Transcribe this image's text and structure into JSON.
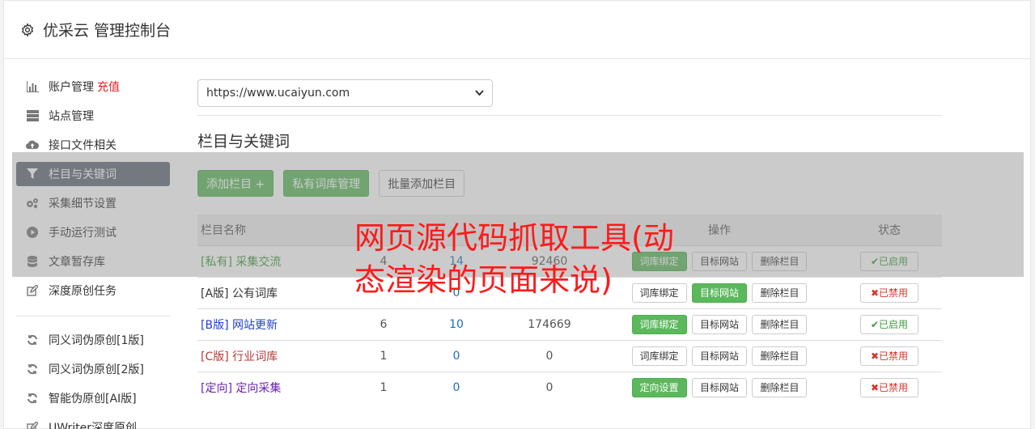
{
  "header": {
    "title": "优采云 管理控制台"
  },
  "sidebar": {
    "items": [
      {
        "label": "账户管理",
        "extra": "充值",
        "icon": "bar-chart-icon"
      },
      {
        "label": "站点管理",
        "icon": "server-icon"
      },
      {
        "label": "接口文件相关",
        "icon": "cloud-upload-icon"
      },
      {
        "label": "栏目与关键词",
        "icon": "filter-icon"
      },
      {
        "label": "采集细节设置",
        "icon": "cogs-icon"
      },
      {
        "label": "手动运行测试",
        "icon": "play-icon"
      },
      {
        "label": "文章暂存库",
        "icon": "database-icon"
      },
      {
        "label": "深度原创任务",
        "icon": "edit-icon"
      }
    ],
    "items2": [
      {
        "label": "同义词伪原创[1版]",
        "icon": "refresh-icon"
      },
      {
        "label": "同义词伪原创[2版]",
        "icon": "refresh-icon"
      },
      {
        "label": "智能伪原创[AI版]",
        "icon": "refresh-icon"
      },
      {
        "label": "UWriter深度原创",
        "icon": "edit-icon"
      }
    ]
  },
  "main": {
    "site_select": "https://www.ucaiyun.com",
    "section_title": "栏目与关键词",
    "buttons": {
      "add_column": "添加栏目 +",
      "private_lib": "私有词库管理",
      "batch_add": "批量添加栏目"
    },
    "table": {
      "headers": [
        "栏目名称",
        "",
        "",
        "",
        "操作",
        "状态"
      ],
      "rows": [
        {
          "name": "[私有] 采集交流",
          "a": "4",
          "b": "14",
          "c": "92460",
          "op1": "词库绑定",
          "op2": "目标网站",
          "op3": "删除栏目",
          "status": "✔已启用"
        },
        {
          "name": "[A版] 公有词库",
          "a": "",
          "b": "0",
          "c": "",
          "op1": "词库绑定",
          "op2": "目标网站",
          "op3": "删除栏目",
          "status": "✖已禁用"
        },
        {
          "name": "[B版] 网站更新",
          "a": "6",
          "b": "10",
          "c": "174669",
          "op1": "词库绑定",
          "op2": "目标网站",
          "op3": "删除栏目",
          "status": "✔已启用"
        },
        {
          "name": "[C版] 行业词库",
          "a": "1",
          "b": "0",
          "c": "0",
          "op1": "词库绑定",
          "op2": "目标网站",
          "op3": "删除栏目",
          "status": "✖已禁用"
        },
        {
          "name": "[定向] 定向采集",
          "a": "1",
          "b": "0",
          "c": "0",
          "op1": "定向设置",
          "op2": "目标网站",
          "op3": "删除栏目",
          "status": "✖已禁用"
        }
      ]
    }
  },
  "watermark": "网页源代码抓取工具(动态渲染的页面来说)"
}
